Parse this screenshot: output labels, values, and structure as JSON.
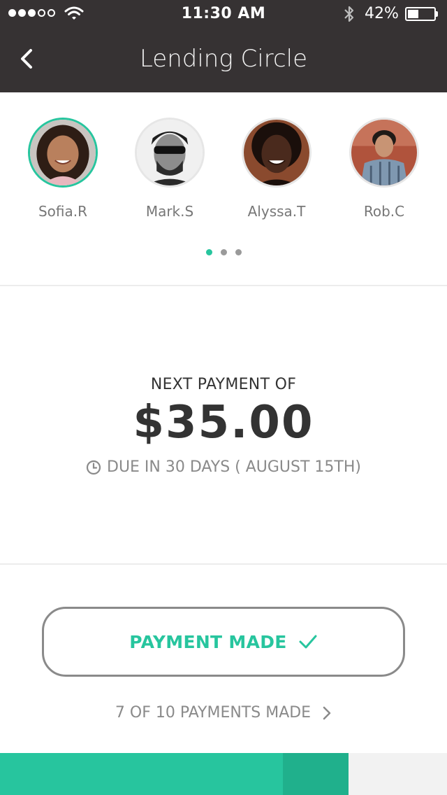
{
  "status_bar": {
    "time": "11:30 AM",
    "battery_percent_text": "42%",
    "battery_level": 0.42,
    "signal_bars_filled": 3,
    "signal_bars_total": 5
  },
  "nav": {
    "title": "Lending Circle",
    "back_icon": "chevron-left-icon"
  },
  "members": [
    {
      "name": "Sofia.R",
      "active": true
    },
    {
      "name": "Mark.S",
      "active": false
    },
    {
      "name": "Alyssa.T",
      "active": false
    },
    {
      "name": "Rob.C",
      "active": false
    }
  ],
  "pager": {
    "pages": 3,
    "current": 1
  },
  "payment": {
    "label": "NEXT PAYMENT OF",
    "amount": "$35.00",
    "due": "DUE IN 30 DAYS ( AUGUST 15TH)",
    "due_icon": "clock-icon"
  },
  "action": {
    "button_label": "PAYMENT MADE",
    "button_icon": "check-icon",
    "progress_text": "7 OF 10 PAYMENTS MADE",
    "progress_icon": "chevron-right-icon"
  },
  "progress": {
    "made": 7,
    "total": 10,
    "current_index": 8
  },
  "colors": {
    "accent": "#27c59e",
    "accent_dark": "#20b08c",
    "header_bg": "#363233"
  }
}
